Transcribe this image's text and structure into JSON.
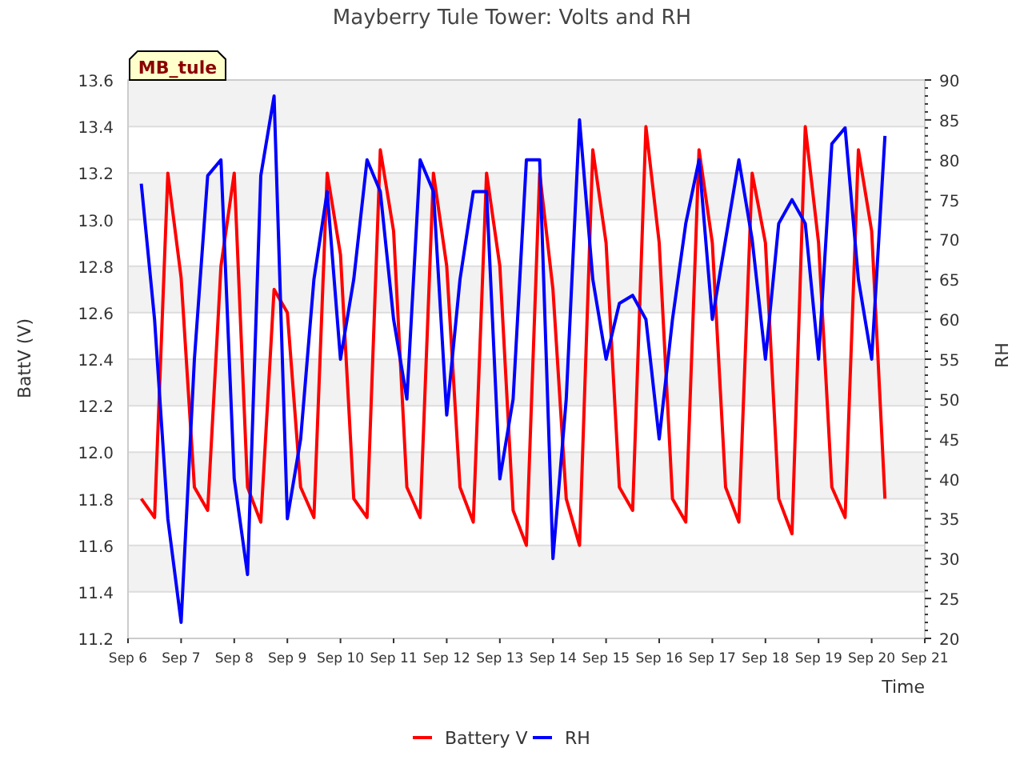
{
  "title": "Mayberry Tule Tower: Volts and RH",
  "badge": "MB_tule",
  "chart_data": {
    "type": "line",
    "grid": true,
    "legend": true,
    "xlabel": "Time",
    "ylabel": "BattV (V)",
    "y2label": "RH",
    "categories": [
      "Sep 6",
      null,
      null,
      null,
      "Sep 7",
      null,
      null,
      null,
      "Sep 8",
      null,
      null,
      null,
      "Sep 9",
      null,
      null,
      null,
      "Sep 10",
      null,
      null,
      null,
      "Sep 11",
      null,
      null,
      null,
      "Sep 12",
      null,
      null,
      null,
      "Sep 13",
      null,
      null,
      null,
      "Sep 14",
      null,
      null,
      null,
      "Sep 15",
      null,
      null,
      null,
      "Sep 16",
      null,
      null,
      null,
      "Sep 17",
      null,
      null,
      null,
      "Sep 18",
      null,
      null,
      null,
      "Sep 19",
      null,
      null,
      null,
      "Sep 20",
      null,
      null,
      null,
      "Sep 21"
    ],
    "ylim": [
      11.2,
      13.6
    ],
    "y2lim": [
      20,
      90
    ],
    "yticks": [
      {
        "value": 11.2,
        "label": "11.2"
      },
      {
        "value": 11.4,
        "label": "11.4"
      },
      {
        "value": 11.6,
        "label": "11.6"
      },
      {
        "value": 11.8,
        "label": "11.8"
      },
      {
        "value": 12.0,
        "label": "12.0"
      },
      {
        "value": 12.2,
        "label": "12.2"
      },
      {
        "value": 12.4,
        "label": "12.4"
      },
      {
        "value": 12.6,
        "label": "12.6"
      },
      {
        "value": 12.8,
        "label": "12.8"
      },
      {
        "value": 13.0,
        "label": "13.0"
      },
      {
        "value": 13.2,
        "label": "13.2"
      },
      {
        "value": 13.4,
        "label": "13.4"
      },
      {
        "value": 13.6,
        "label": "13.6"
      }
    ],
    "y2ticks": [
      20,
      25,
      30,
      35,
      40,
      45,
      50,
      55,
      60,
      65,
      70,
      75,
      80,
      85,
      90
    ],
    "series": [
      {
        "name": "Battery V",
        "color": "#ff0000",
        "axis": "y",
        "values": [
          null,
          11.8,
          11.72,
          13.2,
          12.75,
          11.85,
          11.75,
          12.8,
          13.2,
          11.85,
          11.7,
          12.7,
          12.6,
          11.85,
          11.72,
          13.2,
          12.85,
          11.8,
          11.72,
          13.3,
          12.95,
          11.85,
          11.72,
          13.2,
          12.8,
          11.85,
          11.7,
          13.2,
          12.8,
          11.75,
          11.6,
          13.2,
          12.7,
          11.8,
          11.6,
          13.3,
          12.9,
          11.85,
          11.75,
          13.4,
          12.9,
          11.8,
          11.7,
          13.3,
          12.9,
          11.85,
          11.7,
          13.2,
          12.9,
          11.8,
          11.65,
          13.4,
          12.9,
          11.85,
          11.72,
          13.3,
          12.95,
          11.8,
          null,
          null,
          null
        ]
      },
      {
        "name": "RH",
        "color": "#0000ff",
        "axis": "y2",
        "values": [
          null,
          77,
          60,
          35,
          22,
          55,
          78,
          80,
          40,
          28,
          78,
          88,
          35,
          45,
          65,
          76,
          55,
          65,
          80,
          76,
          60,
          50,
          80,
          76,
          48,
          65,
          76,
          76,
          40,
          50,
          80,
          80,
          30,
          50,
          85,
          65,
          55,
          62,
          63,
          60,
          45,
          60,
          72,
          80,
          60,
          70,
          80,
          70,
          55,
          72,
          75,
          72,
          55,
          82,
          84,
          65,
          55,
          83,
          null,
          null,
          null
        ]
      }
    ]
  }
}
